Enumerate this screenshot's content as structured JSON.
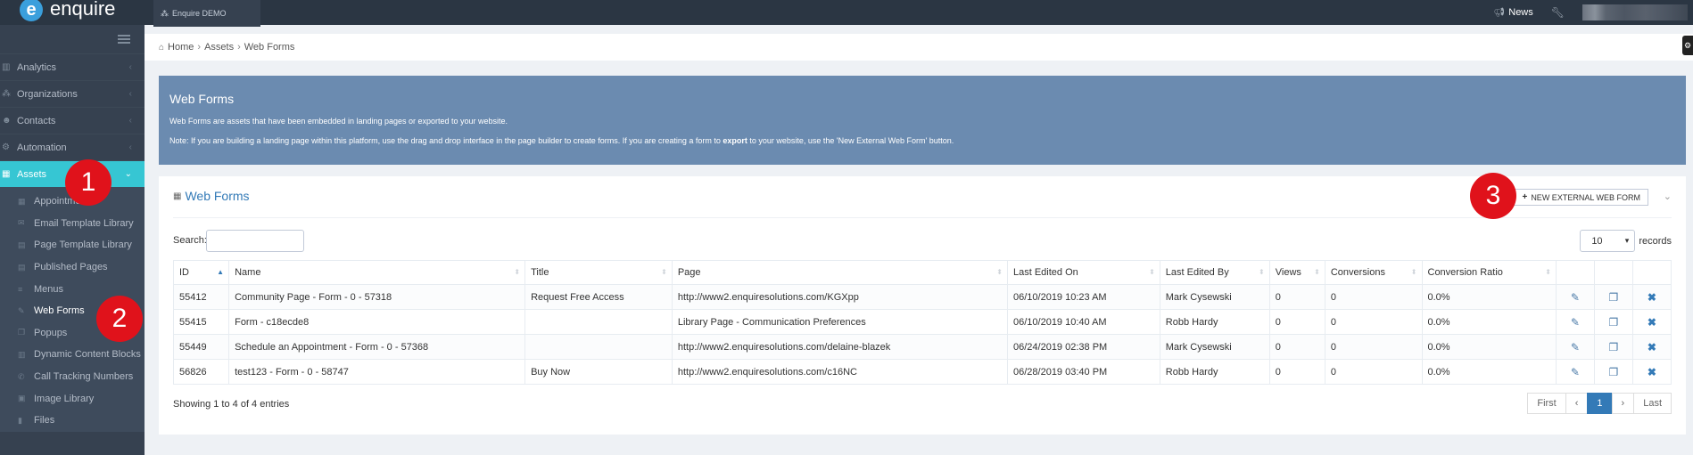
{
  "app": {
    "brand": "enquire",
    "demo_tab": "Enquire DEMO"
  },
  "topbar": {
    "news_label": "News"
  },
  "sidebar": {
    "nav": [
      {
        "label": "Analytics",
        "icon": "bar-chart-icon"
      },
      {
        "label": "Organizations",
        "icon": "sitemap-icon"
      },
      {
        "label": "Contacts",
        "icon": "users-icon"
      },
      {
        "label": "Automation",
        "icon": "gears-icon"
      },
      {
        "label": "Assets",
        "icon": "grid-icon",
        "active": true
      }
    ],
    "sub_items": [
      "Appointments",
      "Email Template Library",
      "Page Template Library",
      "Published Pages",
      "Menus",
      "Web Forms",
      "Popups",
      "Dynamic Content Blocks",
      "Call Tracking Numbers",
      "Image Library",
      "Files"
    ]
  },
  "breadcrumb": {
    "items": [
      "Home",
      "Assets",
      "Web Forms"
    ]
  },
  "notice": {
    "title": "Web Forms",
    "line1": "Web Forms are assets that have been embedded in landing pages or exported to your website.",
    "line2_before": "Note: If you are building a landing page within this platform, use the drag and drop interface in the page builder to create forms. If you are creating a form to ",
    "line2_bold": "export",
    "line2_after": " to your website, use the 'New External Web Form' button."
  },
  "portlet": {
    "title": "Web Forms",
    "new_button": "NEW EXTERNAL WEB FORM",
    "search_label": "Search:",
    "search_value": "",
    "records_value": "10",
    "records_label": "records",
    "summary": "Showing 1 to 4 of 4 entries"
  },
  "table": {
    "headers": [
      "ID",
      "Name",
      "Title",
      "Page",
      "Last Edited On",
      "Last Edited By",
      "Views",
      "Conversions",
      "Conversion Ratio"
    ],
    "rows": [
      [
        "55412",
        "Community Page - Form - 0 - 57318",
        "Request Free Access",
        "http://www2.enquiresolutions.com/KGXpp",
        "06/10/2019 10:23 AM",
        "Mark Cysewski",
        "0",
        "0",
        "0.0%"
      ],
      [
        "55415",
        "Form - c18ecde8",
        "",
        "Library Page - Communication Preferences",
        "06/10/2019 10:40 AM",
        "Robb Hardy",
        "0",
        "0",
        "0.0%"
      ],
      [
        "55449",
        "Schedule an Appointment - Form - 0 - 57368",
        "",
        "http://www2.enquiresolutions.com/delaine-blazek",
        "06/24/2019 02:38 PM",
        "Mark Cysewski",
        "0",
        "0",
        "0.0%"
      ],
      [
        "56826",
        "test123 - Form - 0 - 58747",
        "Buy Now",
        "http://www2.enquiresolutions.com/c16NC",
        "06/28/2019 03:40 PM",
        "Robb Hardy",
        "0",
        "0",
        "0.0%"
      ]
    ]
  },
  "pagination": {
    "first": "First",
    "prev": "‹",
    "current": "1",
    "next": "›",
    "last": "Last"
  },
  "callouts": [
    "1",
    "2",
    "3"
  ],
  "colors": {
    "active_nav": "#36c6d3",
    "notice_bg": "#6b8bb0",
    "callout": "#e0121b",
    "link": "#337ab7"
  }
}
